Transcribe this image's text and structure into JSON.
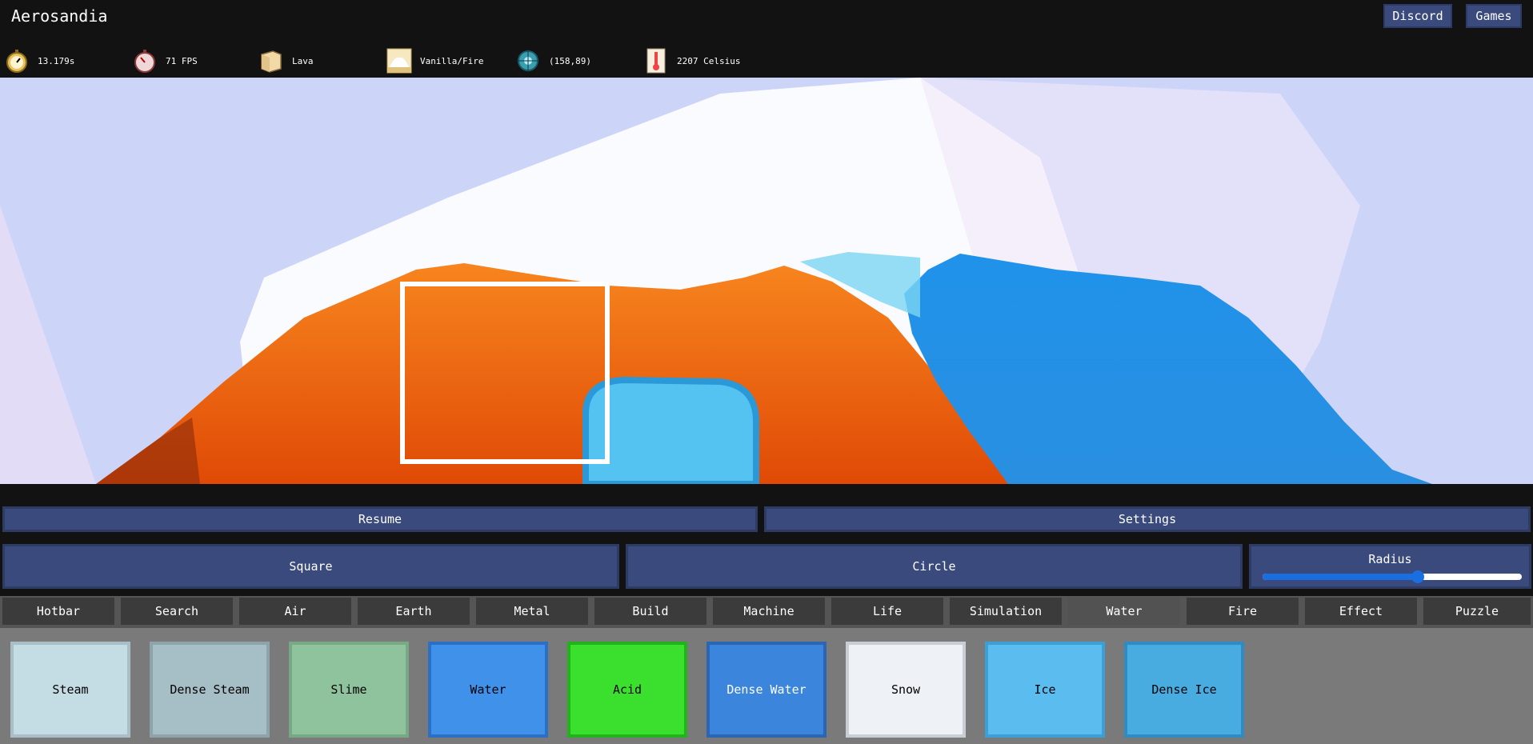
{
  "app": {
    "title": "Aerosandia"
  },
  "top_buttons": {
    "discord": "Discord",
    "games": "Games"
  },
  "stats": [
    {
      "icon": "stopwatch-icon",
      "value": "13.179s"
    },
    {
      "icon": "speedometer-icon",
      "value": "71 FPS"
    },
    {
      "icon": "element-cube-icon",
      "value": "Lava"
    },
    {
      "icon": "cloud-fire-icon",
      "value": "Vanilla/Fire"
    },
    {
      "icon": "cursor-crosshair-icon",
      "value": "(158,89)"
    },
    {
      "icon": "thermometer-icon",
      "value": "2207 Celsius"
    }
  ],
  "controls": {
    "resume": "Resume",
    "settings": "Settings",
    "square": "Square",
    "circle": "Circle",
    "radius": "Radius",
    "radius_value": 0.6
  },
  "tabs": [
    "Hotbar",
    "Search",
    "Air",
    "Earth",
    "Metal",
    "Build",
    "Machine",
    "Life",
    "Simulation",
    "Water",
    "Fire",
    "Effect",
    "Puzzle"
  ],
  "active_tab": "Water",
  "elements": [
    {
      "label": "Steam",
      "bg": "#c4dde4",
      "border": "#a9bec6",
      "text": "#000"
    },
    {
      "label": "Dense Steam",
      "bg": "#a6bec5",
      "border": "#8ea3aa",
      "text": "#000"
    },
    {
      "label": "Slime",
      "bg": "#8fc39d",
      "border": "#78a985",
      "text": "#000"
    },
    {
      "label": "Water",
      "bg": "#3f91ea",
      "border": "#2c6fc6",
      "text": "#000"
    },
    {
      "label": "Acid",
      "bg": "#3be02f",
      "border": "#22b31c",
      "text": "#000"
    },
    {
      "label": "Dense Water",
      "bg": "#3b86dc",
      "border": "#2b66b4",
      "text": "#fff"
    },
    {
      "label": "Snow",
      "bg": "#eef1f6",
      "border": "#c9cdd4",
      "text": "#000"
    },
    {
      "label": "Ice",
      "bg": "#5bbcf0",
      "border": "#3c9fd6",
      "text": "#000"
    },
    {
      "label": "Dense Ice",
      "bg": "#48ace0",
      "border": "#2f8bc4",
      "text": "#000"
    }
  ],
  "colors": {
    "button_bg": "#3a4a7c",
    "sky": "#ccd5f7",
    "lava": "#f26a10",
    "water": "#2f97ea"
  }
}
